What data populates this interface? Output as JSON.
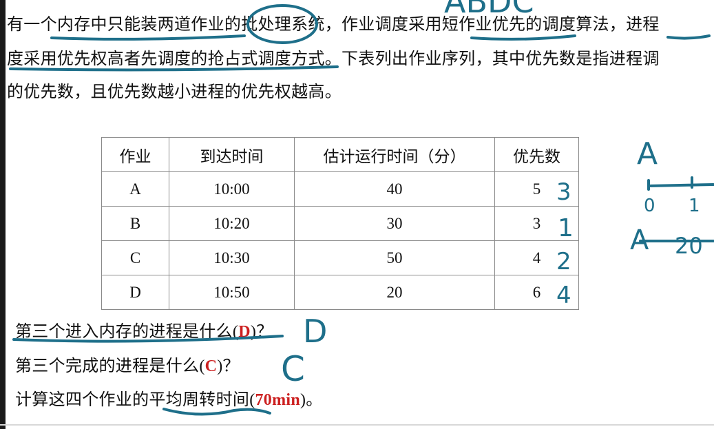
{
  "paragraph": {
    "line1": "有一个内存中只能装两道作业的批处理系统，作业调度采用短作业优先的调度算法，进程",
    "line2": "度采用优先权高者先调度的抢占式调度方式。下表列出作业序列，其中优先数是指进程调",
    "line3": "的优先数，且优先数越小进程的优先权越高。"
  },
  "table": {
    "headers": [
      "作业",
      "到达时间",
      "估计运行时间（分）",
      "优先数"
    ],
    "rows": [
      {
        "job": "A",
        "arrival": "10:00",
        "runtime": "40",
        "priority": "5"
      },
      {
        "job": "B",
        "arrival": "10:20",
        "runtime": "30",
        "priority": "3"
      },
      {
        "job": "C",
        "arrival": "10:30",
        "runtime": "50",
        "priority": "4"
      },
      {
        "job": "D",
        "arrival": "10:50",
        "runtime": "20",
        "priority": "6"
      }
    ]
  },
  "questions": [
    {
      "text": "第三个进入内存的进程是什么",
      "open": "(",
      "answer": "D",
      "close": ")？"
    },
    {
      "text": "第三个完成的进程是什么",
      "open": "(",
      "answer": "C",
      "close": ")？"
    },
    {
      "text": "计算这四个作业的平均周转时间",
      "open": "(",
      "answer": "70min",
      "close": ")。"
    }
  ],
  "handwriting": {
    "top": "ABDC",
    "priority_marks": [
      "3",
      "1",
      "2",
      "4"
    ],
    "answer_marks": [
      "D",
      "C"
    ],
    "timeline_label": "A",
    "tick_0": "0",
    "tick_1": "1",
    "timeline2_label": "A",
    "timeline2_value": "20"
  },
  "colors": {
    "ink": "#1e6f8a",
    "answer": "#cc1f1f"
  }
}
